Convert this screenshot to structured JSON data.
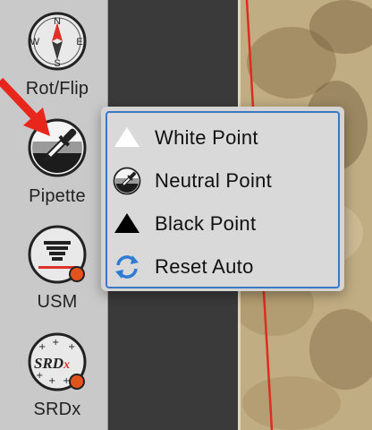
{
  "tools": [
    {
      "id": "rotflip",
      "label": "Rot/Flip",
      "icon": "compass-icon"
    },
    {
      "id": "pipette",
      "label": "Pipette",
      "icon": "pipette-icon"
    },
    {
      "id": "usm",
      "label": "USM",
      "icon": "usm-icon"
    },
    {
      "id": "srdx",
      "label": "SRDx",
      "icon": "srdx-icon"
    }
  ],
  "compass": {
    "n": "N",
    "e": "E",
    "s": "S",
    "w": "W"
  },
  "srdx_badge": "SRDx",
  "menu": {
    "items": [
      {
        "label": "White Point",
        "icon": "white-triangle-icon"
      },
      {
        "label": "Neutral Point",
        "icon": "neutral-pipette-icon"
      },
      {
        "label": "Black Point",
        "icon": "black-triangle-icon"
      },
      {
        "label": "Reset Auto",
        "icon": "reset-arrows-icon"
      }
    ]
  },
  "colors": {
    "accent_blue": "#3b78c4",
    "arrow_red": "#e8261c",
    "badge_orange": "#e2541c",
    "photo_line_red": "#e02c20"
  }
}
